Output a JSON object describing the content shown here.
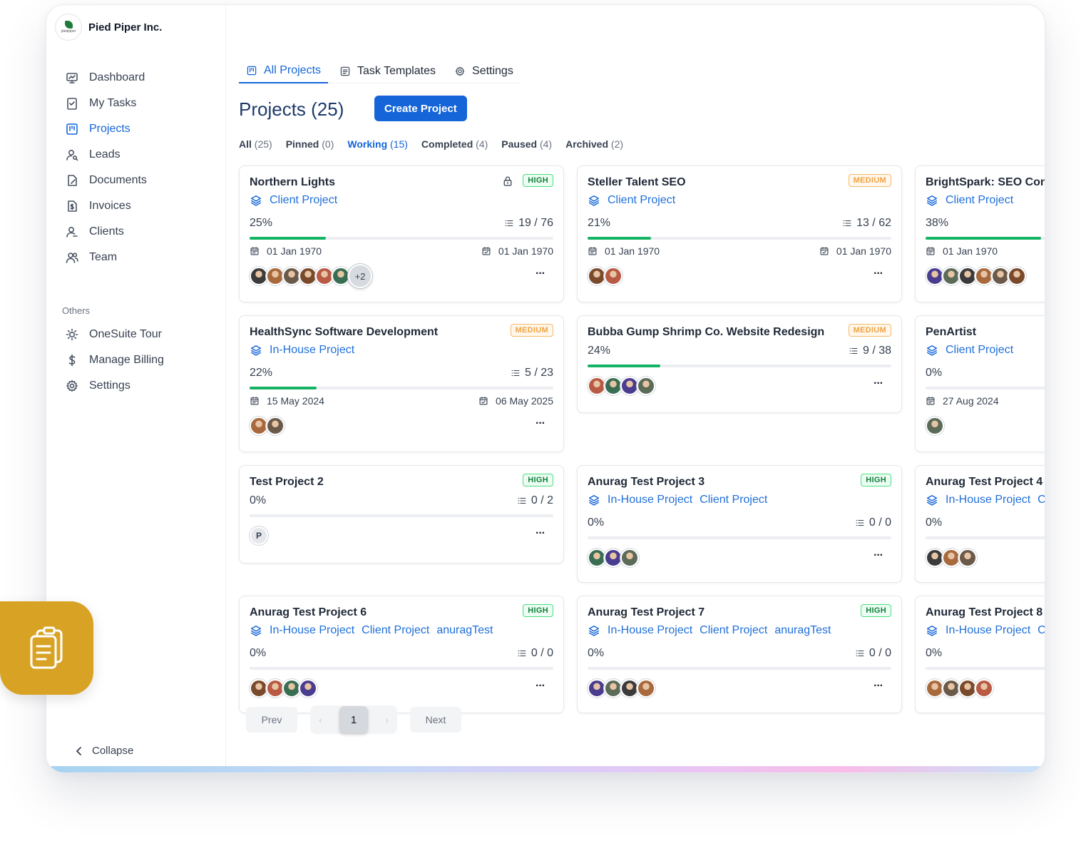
{
  "brand": {
    "name": "Pied Piper Inc.",
    "logo_text": "piedpiper"
  },
  "sidebar": {
    "items": [
      {
        "label": "Dashboard",
        "icon": "dashboard-icon"
      },
      {
        "label": "My Tasks",
        "icon": "tasks-icon"
      },
      {
        "label": "Projects",
        "icon": "projects-icon",
        "active": true
      },
      {
        "label": "Leads",
        "icon": "leads-icon"
      },
      {
        "label": "Documents",
        "icon": "documents-icon"
      },
      {
        "label": "Invoices",
        "icon": "invoices-icon"
      },
      {
        "label": "Clients",
        "icon": "clients-icon"
      },
      {
        "label": "Team",
        "icon": "team-icon"
      }
    ],
    "others_label": "Others",
    "others": [
      {
        "label": "OneSuite Tour",
        "icon": "sun-icon"
      },
      {
        "label": "Manage Billing",
        "icon": "dollar-icon"
      },
      {
        "label": "Settings",
        "icon": "gear-icon"
      }
    ],
    "collapse_label": "Collapse"
  },
  "tabs": [
    {
      "label": "All Projects",
      "active": true
    },
    {
      "label": "Task Templates"
    },
    {
      "label": "Settings"
    }
  ],
  "page": {
    "title": "Projects (25)",
    "create_label": "Create Project"
  },
  "filters": [
    {
      "label": "All",
      "count": "(25)"
    },
    {
      "label": "Pinned",
      "count": "(0)"
    },
    {
      "label": "Working",
      "count": "(15)",
      "active": true
    },
    {
      "label": "Completed",
      "count": "(4)"
    },
    {
      "label": "Paused",
      "count": "(4)"
    },
    {
      "label": "Archived",
      "count": "(2)"
    }
  ],
  "colors": {
    "accent": "#1565d8",
    "progress": "#16b364",
    "high": "#15803d",
    "medium": "#f0a342",
    "tile": "#d8a325"
  },
  "projects": [
    {
      "title": "Northern Lights",
      "priority": "HIGH",
      "locked": true,
      "tags": [
        "Client Project"
      ],
      "percent": "25%",
      "progress": 0.25,
      "tasks": "19 / 76",
      "start": "01 Jan 1970",
      "end": "01 Jan 1970",
      "avatars": 6,
      "more": "+2"
    },
    {
      "title": "Steller Talent SEO",
      "priority": "MEDIUM",
      "tags": [
        "Client Project"
      ],
      "percent": "21%",
      "progress": 0.21,
      "tasks": "13 / 62",
      "start": "01 Jan 1970",
      "end": "01 Jan 1970",
      "avatars": 2
    },
    {
      "title": "BrightSpark: SEO Content Optimization",
      "priority": "",
      "tags": [
        "Client Project"
      ],
      "percent": "38%",
      "progress": 0.38,
      "tasks": "",
      "start": "01 Jan 1970",
      "end": "",
      "avatars": 6
    },
    {
      "title": "HealthSync Software Development",
      "priority": "MEDIUM",
      "tags": [
        "In-House Project"
      ],
      "percent": "22%",
      "progress": 0.22,
      "tasks": "5 / 23",
      "start": "15 May 2024",
      "end": "06 May 2025",
      "avatars": 2
    },
    {
      "title": "Bubba Gump Shrimp Co. Website Redesign",
      "priority": "MEDIUM",
      "tags": [],
      "percent": "24%",
      "progress": 0.24,
      "tasks": "9 / 38",
      "start": "",
      "end": "",
      "avatars": 4
    },
    {
      "title": "PenArtist",
      "priority": "",
      "tags": [
        "Client Project"
      ],
      "percent": "0%",
      "progress": 0,
      "tasks": "",
      "start": "27 Aug 2024",
      "end": "",
      "avatars": 1
    },
    {
      "title": "Test Project 2",
      "priority": "HIGH",
      "tags": [],
      "percent": "0%",
      "progress": 0,
      "tasks": "0 / 2",
      "start": "",
      "end": "",
      "avatars": 1,
      "initial": "P"
    },
    {
      "title": "Anurag Test Project 3",
      "priority": "HIGH",
      "tags": [
        "In-House Project",
        "Client Project"
      ],
      "percent": "0%",
      "progress": 0,
      "tasks": "0 / 0",
      "start": "",
      "end": "",
      "avatars": 3
    },
    {
      "title": "Anurag Test Project 4",
      "priority": "",
      "tags": [
        "In-House Project",
        "Client Project"
      ],
      "percent": "0%",
      "progress": 0,
      "tasks": "",
      "start": "",
      "end": "",
      "avatars": 3
    },
    {
      "title": "Anurag Test Project 6",
      "priority": "HIGH",
      "tags": [
        "In-House Project",
        "Client Project",
        "anuragTest"
      ],
      "percent": "0%",
      "progress": 0,
      "tasks": "0 / 0",
      "start": "",
      "end": "",
      "avatars": 4
    },
    {
      "title": "Anurag Test Project 7",
      "priority": "HIGH",
      "tags": [
        "In-House Project",
        "Client Project",
        "anuragTest"
      ],
      "percent": "0%",
      "progress": 0,
      "tasks": "0 / 0",
      "start": "",
      "end": "",
      "avatars": 4
    },
    {
      "title": "Anurag Test Project 8",
      "priority": "",
      "tags": [
        "In-House Project",
        "Client Project"
      ],
      "percent": "0%",
      "progress": 0,
      "tasks": "",
      "start": "",
      "end": "",
      "avatars": 4
    }
  ],
  "pagination": {
    "prev": "Prev",
    "page": "1",
    "next": "Next"
  },
  "menu_glyph": "···"
}
